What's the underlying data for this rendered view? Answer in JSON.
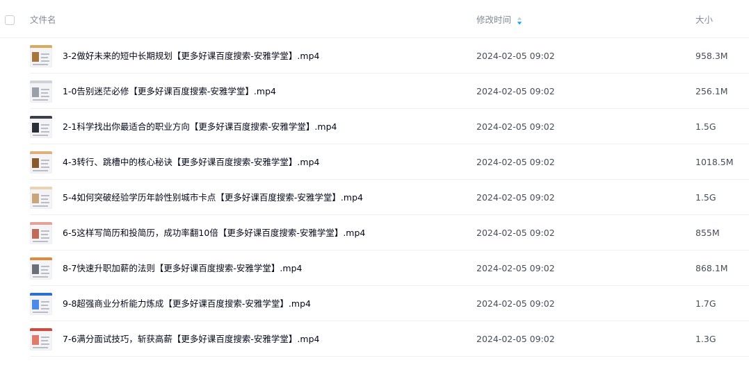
{
  "header": {
    "name_label": "文件名",
    "time_label": "修改时间",
    "size_label": "大小",
    "sort_icon": "sort-arrows-icon"
  },
  "files": [
    {
      "name": "3-2做好未来的短中长期规划【更多好课百度搜索-安雅学堂】.mp4",
      "time": "2024-02-05 09:02",
      "size": "958.3M",
      "icon": "video-thumbnail-icon"
    },
    {
      "name": "1-0告别迷茫必修【更多好课百度搜索-安雅学堂】.mp4",
      "time": "2024-02-05 09:02",
      "size": "256.1M",
      "icon": "video-thumbnail-icon"
    },
    {
      "name": "2-1科学找出你最适合的职业方向【更多好课百度搜索-安雅学堂】.mp4",
      "time": "2024-02-05 09:02",
      "size": "1.5G",
      "icon": "video-thumbnail-icon"
    },
    {
      "name": "4-3转行、跳槽中的核心秘诀【更多好课百度搜索-安雅学堂】.mp4",
      "time": "2024-02-05 09:02",
      "size": "1018.5M",
      "icon": "video-thumbnail-icon"
    },
    {
      "name": "5-4如何突破经验学历年龄性别城市卡点【更多好课百度搜索-安雅学堂】.mp4",
      "time": "2024-02-05 09:02",
      "size": "1.5G",
      "icon": "video-thumbnail-icon"
    },
    {
      "name": "6-5这样写简历和投简历，成功率翻10倍【更多好课百度搜索-安雅学堂】.mp4",
      "time": "2024-02-05 09:02",
      "size": "855M",
      "icon": "video-thumbnail-icon"
    },
    {
      "name": "8-7快速升职加薪的法则【更多好课百度搜索-安雅学堂】.mp4",
      "time": "2024-02-05 09:02",
      "size": "868.1M",
      "icon": "video-thumbnail-icon"
    },
    {
      "name": "9-8超强商业分析能力炼成【更多好课百度搜索-安雅学堂】.mp4",
      "time": "2024-02-05 09:02",
      "size": "1.7G",
      "icon": "video-thumbnail-icon"
    },
    {
      "name": "7-6满分面试技巧，斩获高薪【更多好课百度搜索-安雅学堂】.mp4",
      "time": "2024-02-05 09:02",
      "size": "1.3G",
      "icon": "video-thumbnail-icon"
    }
  ],
  "colors": {
    "sort_accent": "#06a7ff",
    "text_primary": "#03081a",
    "text_secondary": "#818999",
    "divider": "#f0f0f2"
  }
}
